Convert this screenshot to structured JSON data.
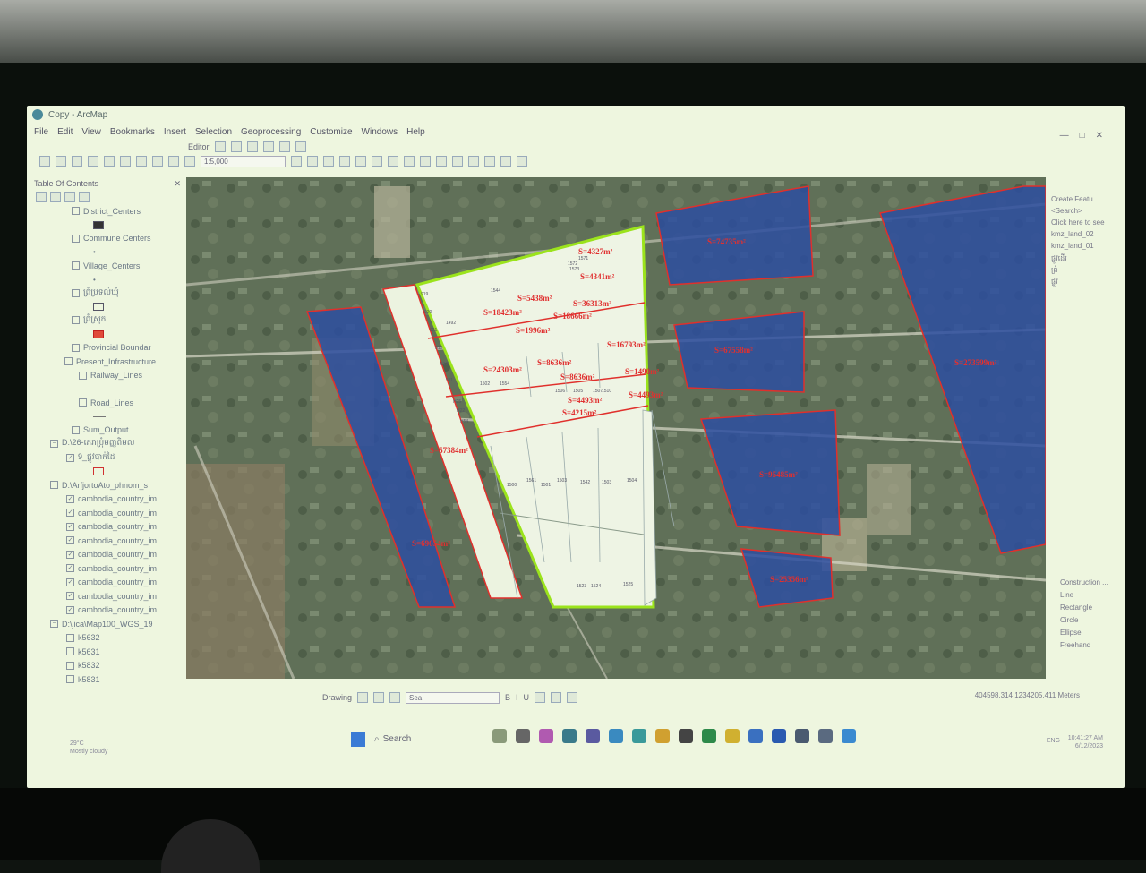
{
  "window": {
    "title": "Copy - ArcMap"
  },
  "menu": [
    "File",
    "Edit",
    "View",
    "Bookmarks",
    "Insert",
    "Selection",
    "Geoprocessing",
    "Customize",
    "Windows",
    "Help"
  ],
  "toolbar": {
    "editor_label": "Editor",
    "scale_value": "1:5,000"
  },
  "toc": {
    "title": "Table Of Contents",
    "layers": [
      "District_Centers",
      "Commune Centers",
      "Village_Centers",
      "ព្រំប្រទល់ឃុំ",
      "ព្រំស្រុក",
      "Provincial Boundar",
      "Present_Infrastructure",
      "Railway_Lines",
      "Road_Lines",
      "Sum_Output",
      "D:\\26-ភេរាប្រុំមញ្ញពិមល",
      "9_ផ្លូវបាក់ដៃ",
      "D:\\ArfjortoAto_phnom_s",
      "cambodia_country_im",
      "cambodia_country_im",
      "cambodia_country_im",
      "cambodia_country_im",
      "cambodia_country_im",
      "cambodia_country_im",
      "cambodia_country_im",
      "cambodia_country_im",
      "cambodia_country_im",
      "D:\\jica\\Map100_WGS_19",
      "k5632",
      "k5631",
      "k5832",
      "k5831"
    ]
  },
  "map": {
    "blue_parcel_labels": [
      "S=74735m²",
      "S=273599m²",
      "S=67558m²",
      "S=95485m²",
      "S=25356m²",
      "S=69654m²",
      "S=57384m²"
    ],
    "green_parcel_labels": [
      "S=4327m²",
      "S=4341m²",
      "S=5438m²",
      "S=18423m²",
      "S=36313m²",
      "S=18666m²",
      "S=1996m²",
      "S=16793m²",
      "S=24303m²",
      "S=8636m²",
      "S=8636m²",
      "S=1490m²",
      "S=4493m²",
      "S=4493m²",
      "S=4215m²"
    ],
    "strip_numbers": [
      "919",
      "920",
      "921",
      "810",
      "512",
      "511",
      "H25",
      "H22",
      "H54"
    ],
    "lot_numbers": [
      "1544",
      "1561",
      "1503",
      "1502",
      "1554",
      "1506",
      "1505",
      "1507",
      "1500",
      "1501",
      "1542",
      "1503",
      "1504",
      "1510",
      "1523",
      "1524",
      "1525",
      "1572",
      "1571",
      "1573",
      "1492"
    ],
    "colors": {
      "blue_fill": "#2d4da0",
      "parcel_outline": "#e0302c",
      "selection_outline": "#9be31c",
      "label_color": "#e03030"
    }
  },
  "right_panel": {
    "title": "Create Featu...",
    "hint": "<Search>",
    "click_hint": "Click here to see",
    "items": [
      "kmz_land_02",
      "kmz_land_01",
      "ផ្លូវដើរ",
      "ព្រំ",
      "ផ្លូវ"
    ],
    "construction_title": "Construction ...",
    "tools": [
      "Line",
      "Rectangle",
      "Circle",
      "Ellipse",
      "Freehand"
    ]
  },
  "drawing": {
    "label": "Drawing",
    "font": "Sea"
  },
  "status": {
    "coords": "404598.314  1234205.411 Meters"
  },
  "taskbar": {
    "weather_temp": "29°C",
    "weather_text": "Mostly cloudy",
    "search_label": "Search",
    "lang": "ENG",
    "time": "10:41:27 AM",
    "date": "6/12/2023"
  }
}
